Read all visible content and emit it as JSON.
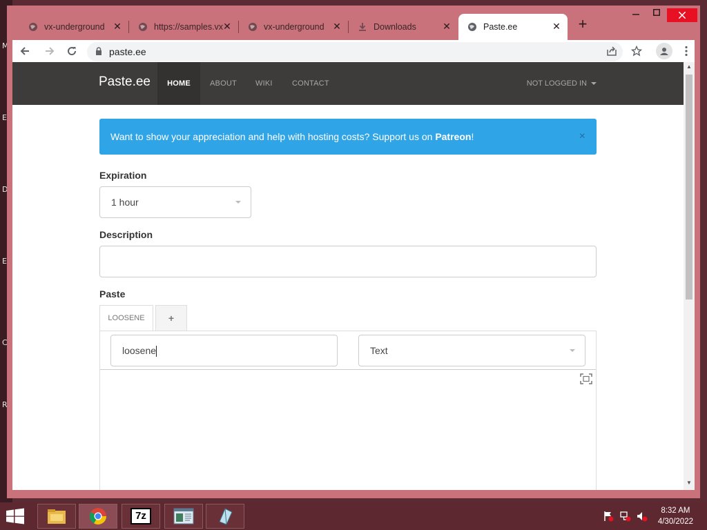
{
  "desktop": {
    "letters": [
      "M",
      "E",
      "D",
      "E",
      "C",
      "R"
    ]
  },
  "browser": {
    "tabs": [
      {
        "label": "vx-underground",
        "icon": "globe-icon"
      },
      {
        "label": "https://samples.vx",
        "icon": "globe-icon"
      },
      {
        "label": "vx-underground",
        "icon": "globe-icon"
      },
      {
        "label": "Downloads",
        "icon": "download-icon"
      },
      {
        "label": "Paste.ee",
        "icon": "globe-icon",
        "active": true
      }
    ],
    "new_tab": "+",
    "url": "paste.ee"
  },
  "site": {
    "brand": "Paste.ee",
    "nav": [
      "HOME",
      "ABOUT",
      "WIKI",
      "CONTACT"
    ],
    "login": "NOT LOGGED IN",
    "alert": {
      "text": "Want to show your appreciation and help with hosting costs? Support us on ",
      "link": "Patreon",
      "suffix": "!",
      "close": "×"
    },
    "expiration_label": "Expiration",
    "expiration_value": "1 hour",
    "description_label": "Description",
    "description_value": "",
    "paste_label": "Paste",
    "paste_tab": "LOOSENE",
    "add_tab": "+",
    "paste_name": "loosene",
    "syntax": "Text"
  },
  "taskbar": {
    "apps": [
      "file-explorer-icon",
      "chrome-icon",
      "7zip-icon",
      "notepad-app-icon",
      "script-app-icon"
    ],
    "seven_zip_label": "7z",
    "time": "8:32 AM",
    "date": "4/30/2022"
  },
  "colors": {
    "navbar": "#3d3c3a",
    "alert": "#2fa4e7",
    "titlebar": "#c9727c",
    "taskbar": "#5e2830"
  }
}
